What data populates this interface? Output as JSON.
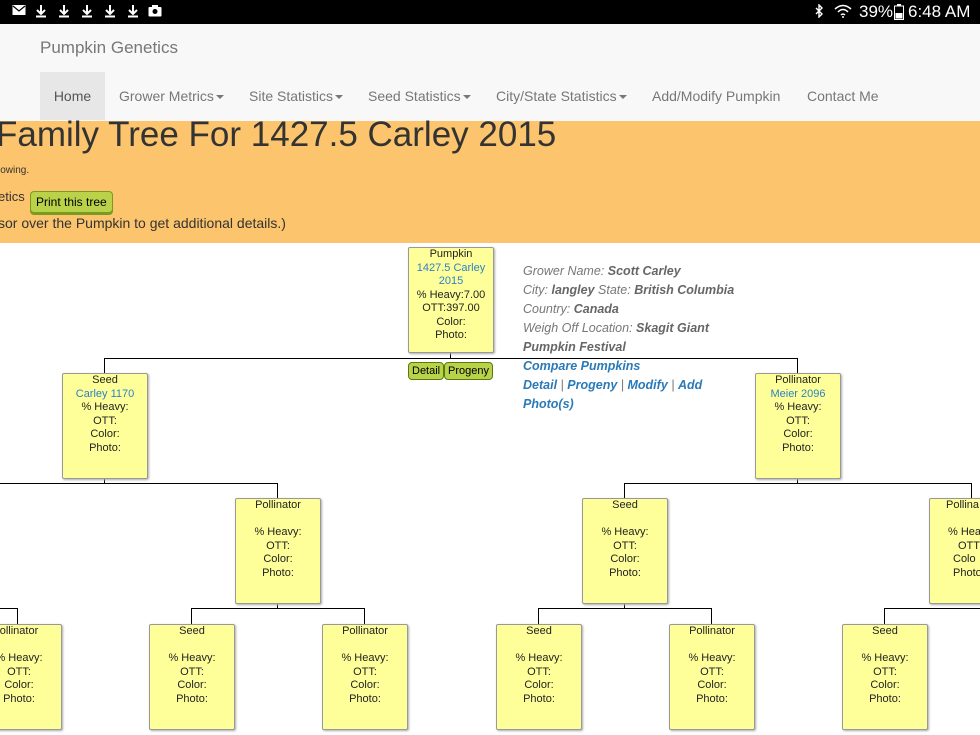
{
  "status_bar": {
    "battery": "39%",
    "time": "6:48 AM"
  },
  "navbar": {
    "brand": "Pumpkin Genetics",
    "items": [
      {
        "label": "Home"
      },
      {
        "label": "Grower Metrics"
      },
      {
        "label": "Site Statistics"
      },
      {
        "label": "Seed Statistics"
      },
      {
        "label": "City/State Statistics"
      },
      {
        "label": "Add/Modify Pumpkin"
      },
      {
        "label": "Contact Me"
      }
    ]
  },
  "banner": {
    "title": "Family Tree For 1427.5 Carley 2015",
    "line1": "lowing.",
    "line2": "etics",
    "print_button": "Print this tree",
    "line3": "sor over the Pumpkin to get additional details.)"
  },
  "root": {
    "role": "Pumpkin",
    "name_line1": "1427.5 Carley",
    "name_line2": "2015",
    "heavy": "% Heavy:7.00",
    "ott": "OTT:397.00",
    "color": "Color:",
    "photo": "Photo:",
    "detail_button": "Detail",
    "progeny_button": "Progeny"
  },
  "info": {
    "grower_label": "Grower Name:",
    "grower_value": "Scott Carley",
    "city_label": "City:",
    "city_value": "langley",
    "state_label": "State:",
    "state_value": "British Columbia",
    "country_label": "Country:",
    "country_value": "Canada",
    "weigh_label": "Weigh Off Location:",
    "weigh_value_1": "Skagit Giant",
    "weigh_value_2": "Pumpkin Festival",
    "compare": "Compare Pumpkins",
    "detail": "Detail",
    "progeny": "Progeny",
    "modify": "Modify",
    "add": "Add",
    "photos": "Photo(s)",
    "sep": "|"
  },
  "level1": {
    "seed": {
      "role": "Seed",
      "name": "Carley 1170",
      "heavy": "% Heavy:",
      "ott": "OTT:",
      "color": "Color:",
      "photo": "Photo:"
    },
    "pollinator": {
      "role": "Pollinator",
      "name": "Meier 2096",
      "heavy": "% Heavy:",
      "ott": "OTT:",
      "color": "Color:",
      "photo": "Photo:"
    }
  },
  "level2": {
    "pollinator_a": {
      "role": "Pollinator",
      "heavy": "% Heavy:",
      "ott": "OTT:",
      "color": "Color:",
      "photo": "Photo:"
    },
    "seed_b": {
      "role": "Seed",
      "heavy": "% Heavy:",
      "ott": "OTT:",
      "color": "Color:",
      "photo": "Photo:"
    },
    "pollinator_b": {
      "role": "Pollina",
      "heavy": "% Heav",
      "ott": "OTT",
      "color": "Colo",
      "photo": "Photo"
    }
  },
  "level3": {
    "n1": {
      "role": "ollinator",
      "heavy": "% Heavy:",
      "ott": "OTT:",
      "color": "Color:",
      "photo": "Photo:"
    },
    "n2": {
      "role": "Seed",
      "heavy": "% Heavy:",
      "ott": "OTT:",
      "color": "Color:",
      "photo": "Photo:"
    },
    "n3": {
      "role": "Pollinator",
      "heavy": "% Heavy:",
      "ott": "OTT:",
      "color": "Color:",
      "photo": "Photo:"
    },
    "n4": {
      "role": "Seed",
      "heavy": "% Heavy:",
      "ott": "OTT:",
      "color": "Color:",
      "photo": "Photo:"
    },
    "n5": {
      "role": "Pollinator",
      "heavy": "% Heavy:",
      "ott": "OTT:",
      "color": "Color:",
      "photo": "Photo:"
    },
    "n6": {
      "role": "Seed",
      "heavy": "% Heavy:",
      "ott": "OTT:",
      "color": "Color:",
      "photo": "Photo:"
    }
  }
}
